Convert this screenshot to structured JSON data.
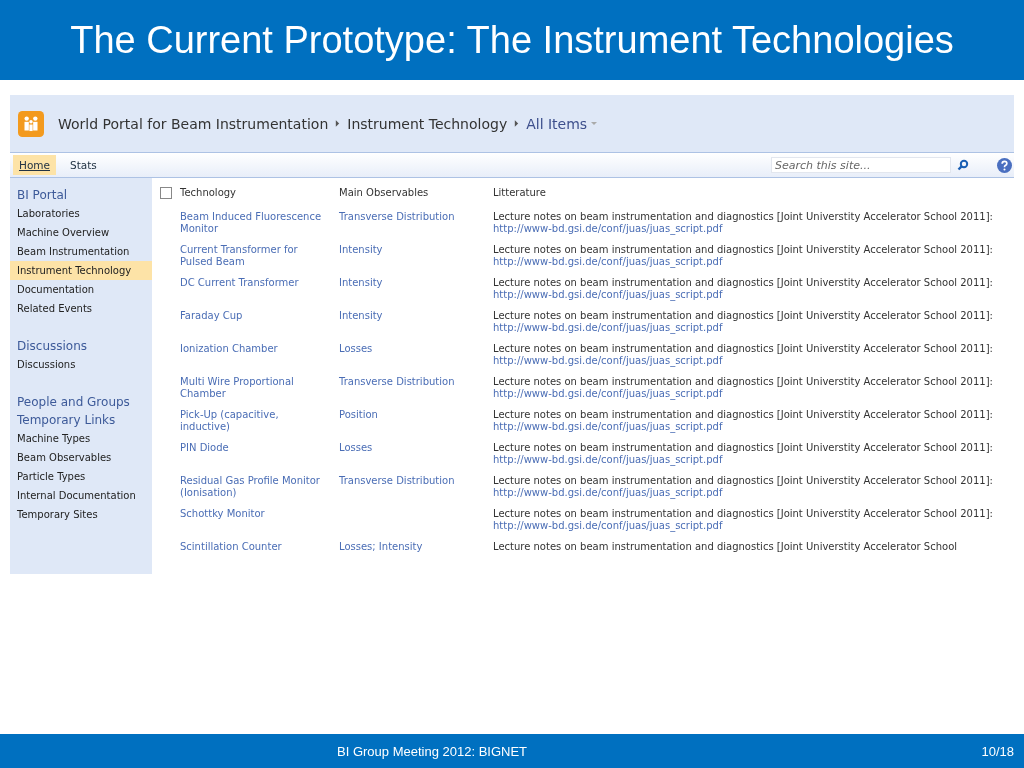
{
  "slide": {
    "title": "The Current Prototype: The Instrument Technologies",
    "footer": "BI Group Meeting 2012: BIGNET",
    "page": "10/18"
  },
  "site": {
    "breadcrumb": [
      "World Portal for Beam Instrumentation",
      "Instrument Technology"
    ],
    "view": "All Items"
  },
  "nav": {
    "tabs": [
      {
        "label": "Home",
        "selected": true
      },
      {
        "label": "Stats",
        "selected": false
      }
    ],
    "search": {
      "placeholder": "Search this site..."
    }
  },
  "sidebar": {
    "sections": [
      {
        "heading": "BI Portal",
        "items": [
          {
            "label": "Laboratories",
            "selected": false
          },
          {
            "label": "Machine Overview",
            "selected": false
          },
          {
            "label": "Beam Instrumentation",
            "selected": false
          },
          {
            "label": "Instrument Technology",
            "selected": true
          },
          {
            "label": "Documentation",
            "selected": false
          },
          {
            "label": "Related Events",
            "selected": false
          }
        ]
      },
      {
        "heading": "Discussions",
        "items": [
          {
            "label": "Discussions",
            "selected": false
          }
        ]
      },
      {
        "heading": "People and Groups"
      },
      {
        "heading": "Temporary Links",
        "items": [
          {
            "label": "Machine Types",
            "selected": false
          },
          {
            "label": "Beam Observables",
            "selected": false
          },
          {
            "label": "Particle Types",
            "selected": false
          },
          {
            "label": "Internal Documentation",
            "selected": false
          },
          {
            "label": "Temporary Sites",
            "selected": false
          }
        ]
      }
    ]
  },
  "table": {
    "select_all": {
      "checked": false
    },
    "columns": [
      "Technology",
      "Main Observables",
      "Litterature"
    ],
    "rows": [
      {
        "technology": "Beam Induced Fluorescence Monitor",
        "observables": "Transverse Distribution",
        "literature": {
          "text": "Lecture notes on beam instrumentation and diagnostics [Joint Universtity Accelerator School 2011]:",
          "link": "http://www-bd.gsi.de/conf/juas/juas_script.pdf"
        }
      },
      {
        "technology": "Current Transformer for Pulsed Beam",
        "observables": "Intensity",
        "literature": {
          "text": "Lecture notes on beam instrumentation and diagnostics [Joint Universtity Accelerator School 2011]:",
          "link": "http://www-bd.gsi.de/conf/juas/juas_script.pdf"
        }
      },
      {
        "technology": "DC Current Transformer",
        "observables": "Intensity",
        "literature": {
          "text": "Lecture notes on beam instrumentation and diagnostics [Joint Universtity Accelerator School 2011]:",
          "link": "http://www-bd.gsi.de/conf/juas/juas_script.pdf"
        }
      },
      {
        "technology": "Faraday Cup",
        "observables": "Intensity",
        "literature": {
          "text": "Lecture notes on beam instrumentation and diagnostics [Joint Universtity Accelerator School 2011]:",
          "link": "http://www-bd.gsi.de/conf/juas/juas_script.pdf"
        }
      },
      {
        "technology": "Ionization Chamber",
        "observables": "Losses",
        "literature": {
          "text": "Lecture notes on beam instrumentation and diagnostics [Joint Universtity Accelerator School 2011]:",
          "link": "http://www-bd.gsi.de/conf/juas/juas_script.pdf"
        }
      },
      {
        "technology": "Multi Wire Proportional Chamber",
        "observables": "Transverse Distribution",
        "literature": {
          "text": "Lecture notes on beam instrumentation and diagnostics [Joint Universtity Accelerator School 2011]:",
          "link": "http://www-bd.gsi.de/conf/juas/juas_script.pdf"
        }
      },
      {
        "technology": "Pick-Up (capacitive, inductive)",
        "observables": "Position",
        "literature": {
          "text": "Lecture notes on beam instrumentation and diagnostics [Joint Universtity Accelerator School 2011]:",
          "link": "http://www-bd.gsi.de/conf/juas/juas_script.pdf"
        }
      },
      {
        "technology": "PIN Diode",
        "observables": "Losses",
        "literature": {
          "text": "Lecture notes on beam instrumentation and diagnostics [Joint Universtity Accelerator School 2011]:",
          "link": "http://www-bd.gsi.de/conf/juas/juas_script.pdf"
        }
      },
      {
        "technology": "Residual Gas Profile Monitor (Ionisation)",
        "observables": "Transverse Distribution",
        "literature": {
          "text": "Lecture notes on beam instrumentation and diagnostics [Joint Universtity Accelerator School 2011]:",
          "link": "http://www-bd.gsi.de/conf/juas/juas_script.pdf"
        }
      },
      {
        "technology": "Schottky Monitor",
        "literature": {
          "text": "Lecture notes on beam instrumentation and diagnostics [Joint Universtity Accelerator School 2011]:",
          "link": "http://www-bd.gsi.de/conf/juas/juas_script.pdf"
        }
      },
      {
        "technology": "Scintillation Counter",
        "observables": "Losses; Intensity",
        "literature": {
          "text": "Lecture notes on beam instrumentation and diagnostics [Joint Universtity Accelerator School"
        }
      }
    ]
  }
}
